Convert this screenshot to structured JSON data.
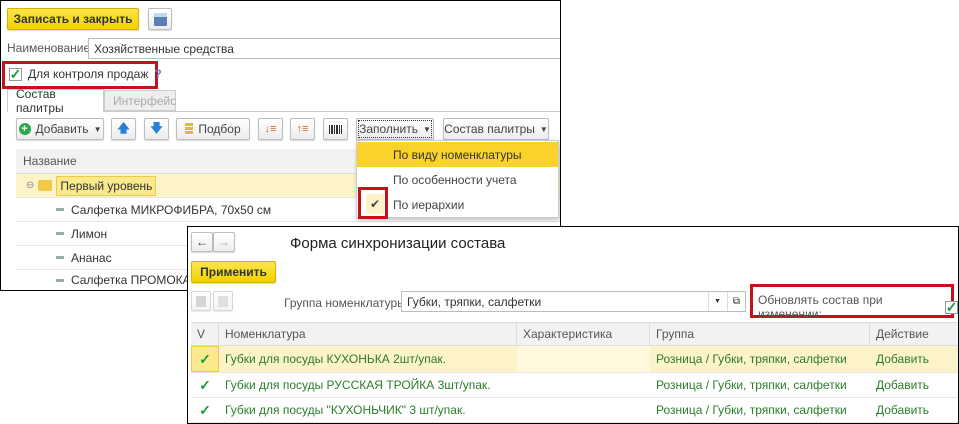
{
  "back_form": {
    "save_close_label": "Записать и закрыть",
    "name_label": "Наименование:",
    "name_value": "Хозяйственные средства",
    "sales_control_label": "Для контроля продаж",
    "sales_control_checked": true,
    "help_mark": "?",
    "tabs": [
      {
        "label": "Состав палитры",
        "active": true
      },
      {
        "label": "Интерфейс",
        "active": false
      }
    ],
    "toolbar": {
      "add_label": "Добавить",
      "pick_label": "Подбор",
      "fill_label": "Заполнить",
      "palette_label": "Состав палитры"
    },
    "fill_menu": [
      {
        "label": "По виду номенклатуры",
        "highlighted": true
      },
      {
        "label": "По особенности учета"
      },
      {
        "label": "По иерархии",
        "checked": true
      }
    ],
    "table": {
      "column": "Название",
      "rows": [
        "Первый уровень",
        "Салфетка МИКРОФИБРА, 70х50 см",
        "Лимон",
        "Ананас",
        "Салфетка ПРОМОКАЛ"
      ]
    }
  },
  "sync_form": {
    "title": "Форма синхронизации состава",
    "apply_label": "Применить",
    "group_label": "Группа номенклатуры:",
    "group_value": "Губки, тряпки, салфетки",
    "update_label": "Обновлять состав при изменении:",
    "update_checked": true,
    "columns": [
      "V",
      "Номенклатура",
      "Характеристика",
      "Группа",
      "Действие"
    ],
    "rows": [
      {
        "checked": true,
        "item": "Губки для посуды КУХОНЬКА 2шт/упак.",
        "feature": "",
        "group": "Розница / Губки, тряпки, салфетки",
        "action": "Добавить"
      },
      {
        "checked": true,
        "item": "Губки для посуды РУССКАЯ ТРОЙКА 3шт/упак.",
        "feature": "",
        "group": "Розница / Губки, тряпки, салфетки",
        "action": "Добавить"
      },
      {
        "checked": true,
        "item": "Губки для посуды \"КУХОНЬЧИК\" 3 шт/упак.",
        "feature": "",
        "group": "Розница / Губки, тряпки, салфетки",
        "action": "Добавить"
      }
    ]
  },
  "colors": {
    "accent_yellow": "#f2d200",
    "highlight_row": "#fdf3c8",
    "red_frame": "#c8101a",
    "green_text": "#2a7d2a"
  }
}
